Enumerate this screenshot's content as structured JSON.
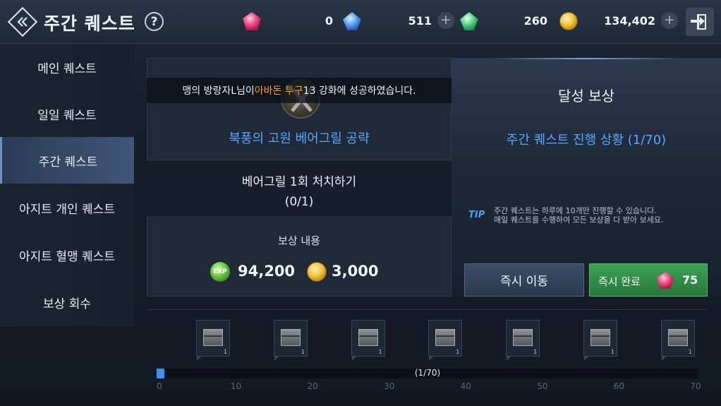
{
  "header": {
    "title": "주간 퀘스트",
    "help_label": "?",
    "currencies": [
      {
        "icon": "red-gem-icon",
        "value": "0",
        "has_plus": false
      },
      {
        "icon": "blue-gem-icon",
        "value": "511",
        "has_plus": true
      },
      {
        "icon": "green-gem-icon",
        "value": "260",
        "has_plus": false
      },
      {
        "icon": "gold-coin-icon",
        "value": "134,402",
        "has_plus": true
      }
    ],
    "plus_label": "+"
  },
  "sidebar": {
    "items": [
      {
        "label": "메인 퀘스트",
        "active": false
      },
      {
        "label": "일일 퀘스트",
        "active": false
      },
      {
        "label": "주간 퀘스트",
        "active": true
      },
      {
        "label": "아지트 개인 퀘스트",
        "active": false
      },
      {
        "label": "아지트 혈맹 퀘스트",
        "active": false
      },
      {
        "label": "보상 회수",
        "active": false
      }
    ]
  },
  "notice": {
    "prefix": "맹의 방랑자L님이 ",
    "highlight": "아바돈 투구",
    "suffix": " 13 강화에 성공하였습니다."
  },
  "quest": {
    "title": "북풍의 고원 베어그릴 공략",
    "task": "베어그릴 1회 처치하기",
    "task_progress": "(0/1)",
    "reward_label": "보상 내용",
    "exp_icon_text": "EXP",
    "exp_value": "94,200",
    "gold_value": "3,000"
  },
  "achievement": {
    "title": "달성 보상",
    "progress": "주간 퀘스트 진행 상황 (1/70)",
    "tip_tag": "TIP",
    "tip_line1": "주간 퀘스트는 하루에 10개만 진행할 수 있습니다.",
    "tip_line2": "매일 퀘스트를 수행하여 모든 보상을 다 받아 보세요."
  },
  "buttons": {
    "move": "즉시 이동",
    "complete": "즉시 완료",
    "complete_cost": "75"
  },
  "progress_bar": {
    "current": 1,
    "max": 70,
    "label": "(1/70)",
    "ticks": [
      "0",
      "10",
      "20",
      "30",
      "40",
      "50",
      "60",
      "70"
    ],
    "reward_qty": [
      "1",
      "1",
      "1",
      "1",
      "1",
      "1",
      "1"
    ]
  },
  "colors": {
    "accent_blue": "#59a8ff",
    "highlight_orange": "#f6a02e",
    "complete_green": "#3ea055"
  }
}
